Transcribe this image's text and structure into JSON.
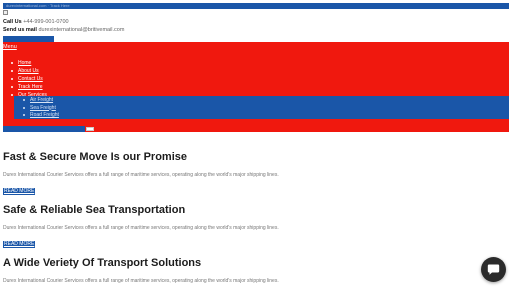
{
  "topbar": {
    "text": "durexinternational.com · Track Here"
  },
  "contact": {
    "call_label": "Call Us",
    "call_value": "+44-999-001-0700",
    "mail_label": "Send us mail",
    "mail_value": "durexinternational@britivemail.com"
  },
  "nav": {
    "menu_label": "Menu",
    "items": [
      {
        "label": "Home"
      },
      {
        "label": "About Us"
      },
      {
        "label": "Contact Us"
      },
      {
        "label": "Track Here"
      },
      {
        "label": "Our Services"
      }
    ],
    "services": [
      {
        "label": "Air Freight"
      },
      {
        "label": "Sea Freight"
      },
      {
        "label": "Road Freight"
      }
    ]
  },
  "sections": [
    {
      "title": "Fast & Secure Move Is our Promise",
      "body": "Durex International Courier Services offers a full range of maritime services, operating along the world's major shipping lines.",
      "cta": "READ MORE"
    },
    {
      "title": "Safe & Reliable Sea Transportation",
      "body": "Durex International Courier Services offers a full range of maritime services, operating along the world's major shipping lines.",
      "cta": "READ MORE"
    },
    {
      "title": "A Wide Veriety Of Transport Solutions",
      "body": "Durex International Courier Services offers a full range of maritime services, operating along the world's major shipping lines."
    }
  ],
  "colors": {
    "brand_blue": "#1a56a8",
    "brand_red": "#f0180e",
    "chat_bg": "#2b2b2b"
  },
  "icons": {
    "chat": "chat-bubble-icon",
    "logo": "broken-image-icon"
  }
}
